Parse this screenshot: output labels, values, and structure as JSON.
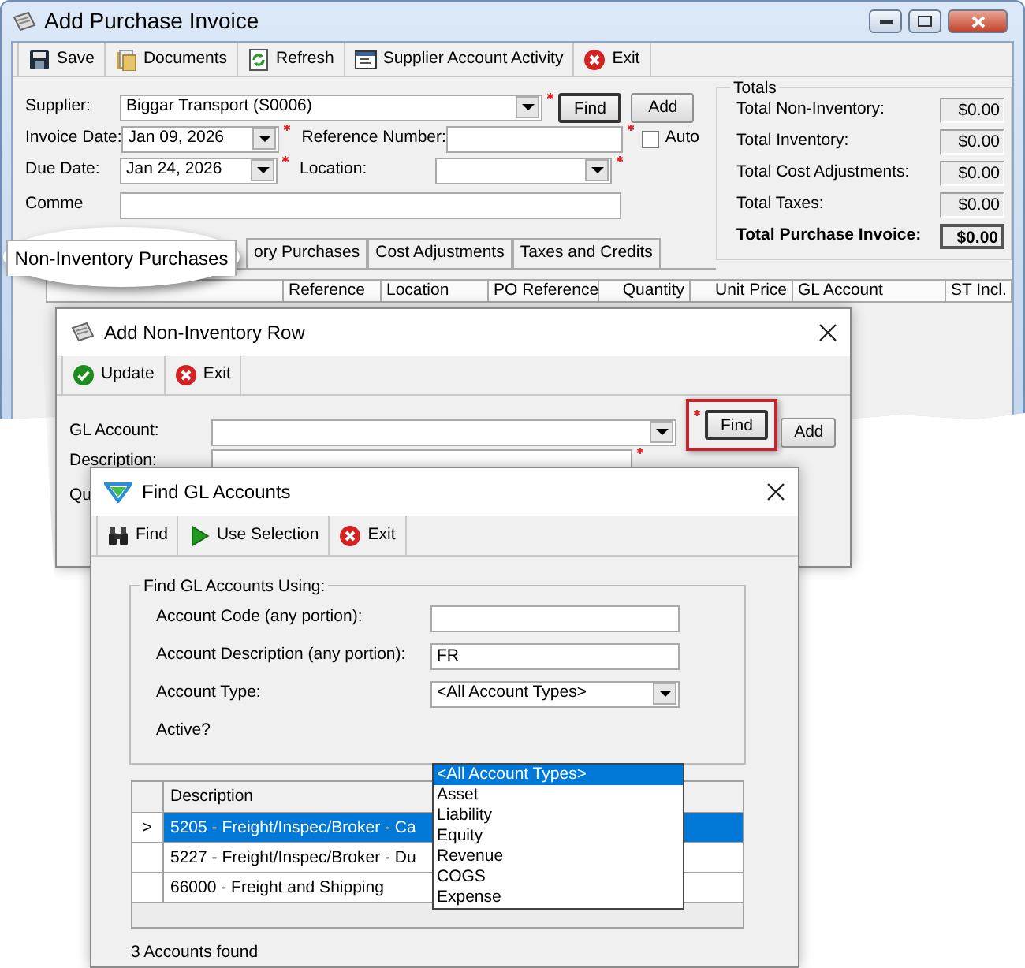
{
  "main_window": {
    "title": "Add Purchase Invoice",
    "toolbar": [
      {
        "label": "Save",
        "kind": "save"
      },
      {
        "label": "Documents",
        "kind": "documents"
      },
      {
        "label": "Refresh",
        "kind": "refresh"
      },
      {
        "label": "Supplier Account Activity",
        "kind": "activity"
      },
      {
        "label": "Exit",
        "kind": "exit"
      }
    ],
    "supplier": {
      "label": "Supplier:",
      "value": "Biggar Transport (S0006)",
      "required": true
    },
    "find_button": "Find",
    "add_button": "Add",
    "invoice_date": {
      "label": "Invoice Date:",
      "value": "Jan  09, 2026",
      "required": true
    },
    "reference_number": {
      "label": "Reference Number:",
      "required": true
    },
    "auto": {
      "label": "Auto",
      "checked": false
    },
    "due_date": {
      "label": "Due Date:",
      "value": "Jan  24, 2026",
      "required": true
    },
    "location": {
      "label": "Location:",
      "required": true
    },
    "comments": {
      "label": "Comme"
    },
    "totals": {
      "title": "Totals",
      "rows": [
        {
          "label": "Total Non-Inventory:",
          "value": "$0.00",
          "kind": "normal"
        },
        {
          "label": "Total Inventory:",
          "value": "$0.00",
          "kind": "normal"
        },
        {
          "label": "Total Cost Adjustments:",
          "value": "$0.00",
          "kind": "normal"
        },
        {
          "label": "Total Taxes:",
          "value": "$0.00",
          "kind": "normal"
        },
        {
          "label": "Total Purchase Invoice:",
          "value": "$0.00",
          "kind": "grand"
        }
      ]
    },
    "tabs": [
      {
        "label": "Non-Inventory Purchases",
        "selected": true,
        "kind": "callout"
      },
      {
        "label": "ory Purchases",
        "selected": false,
        "kind": "tab"
      },
      {
        "label": "Cost Adjustments",
        "selected": false,
        "kind": "tab"
      },
      {
        "label": "Taxes and Credits",
        "selected": false,
        "kind": "tab"
      }
    ],
    "columns": [
      "Reference",
      "Location",
      "PO Reference",
      "Quantity",
      "Unit Price",
      "GL Account",
      "ST Incl."
    ]
  },
  "row_window": {
    "title": "Add Non-Inventory Row",
    "toolbar": [
      {
        "label": "Update",
        "kind": "update"
      },
      {
        "label": "Exit",
        "kind": "exit"
      }
    ],
    "gl_account": {
      "label": "GL Account:",
      "required": true
    },
    "find_button": "Find",
    "find_highlighted": true,
    "add_button": "Add",
    "description": {
      "label": "Description:",
      "required": true
    },
    "quantity": {
      "label": "Qu"
    }
  },
  "find_window": {
    "title": "Find GL Accounts",
    "toolbar": [
      {
        "label": "Find",
        "kind": "find"
      },
      {
        "label": "Use Selection",
        "kind": "use"
      },
      {
        "label": "Exit",
        "kind": "exit"
      }
    ],
    "group_title": "Find GL Accounts Using:",
    "account_code": {
      "label": "Account Code (any portion):"
    },
    "account_description": {
      "label": "Account Description (any portion):",
      "value": "FR"
    },
    "account_type": {
      "label": "Account Type:",
      "value": "<All Account Types>"
    },
    "active": {
      "label": "Active?"
    },
    "type_options": [
      {
        "label": "<All Account Types>",
        "selected": true
      },
      {
        "label": "Asset",
        "selected": false
      },
      {
        "label": "Liability",
        "selected": false
      },
      {
        "label": "Equity",
        "selected": false
      },
      {
        "label": "Revenue",
        "selected": false
      },
      {
        "label": "COGS",
        "selected": false
      },
      {
        "label": "Expense",
        "selected": false
      }
    ],
    "table": {
      "columns": [
        "Description"
      ],
      "rows": [
        {
          "marker": ">",
          "description": "5205 - Freight/Inspec/Broker - Ca",
          "selected": true
        },
        {
          "description": "5227 - Freight/Inspec/Broker - Du",
          "selected": false
        },
        {
          "description": "66000 - Freight and Shipping",
          "selected": false
        }
      ]
    },
    "status": "3 Accounts found"
  }
}
